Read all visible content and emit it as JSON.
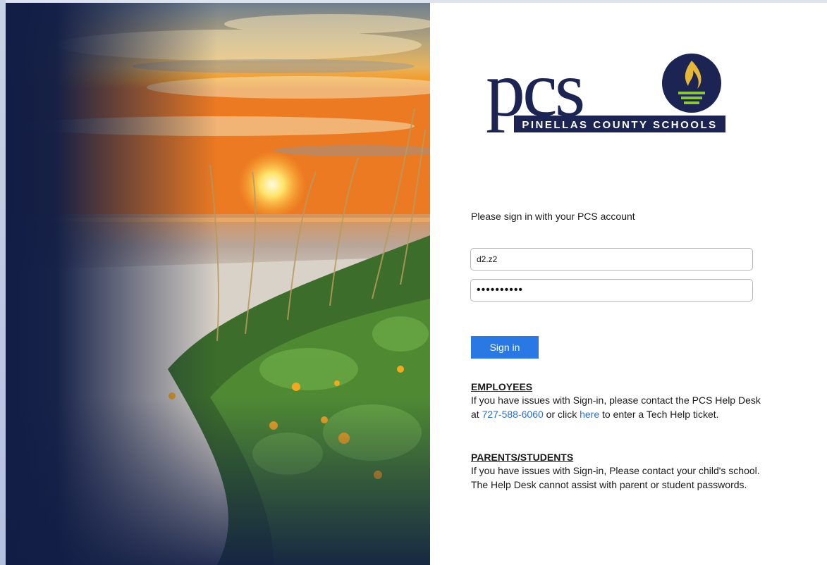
{
  "logo": {
    "wordmark": "pcs",
    "tagline": "PINELLAS COUNTY SCHOOLS"
  },
  "signin": {
    "prompt": "Please sign in with your PCS account",
    "username_value": "d2.z2",
    "password_value": "••••••••••",
    "button_label": "Sign in"
  },
  "employees": {
    "heading": "EMPLOYEES",
    "text_before_phone": "If you have issues with Sign-in, please contact the PCS Help Desk at ",
    "phone": "727-588-6060",
    "text_before_link": " or click ",
    "link_label": "here",
    "text_after_link": " to enter a Tech Help ticket."
  },
  "parents": {
    "heading": "PARENTS/STUDENTS",
    "text": "If you have issues with Sign-in, Please contact your child's school. The Help Desk cannot assist with parent or student passwords."
  },
  "colors": {
    "navy": "#1b2453",
    "gold": "#e5b83a",
    "green": "#8cc63f",
    "button": "#2a78e4",
    "link": "#2a6fd6"
  }
}
